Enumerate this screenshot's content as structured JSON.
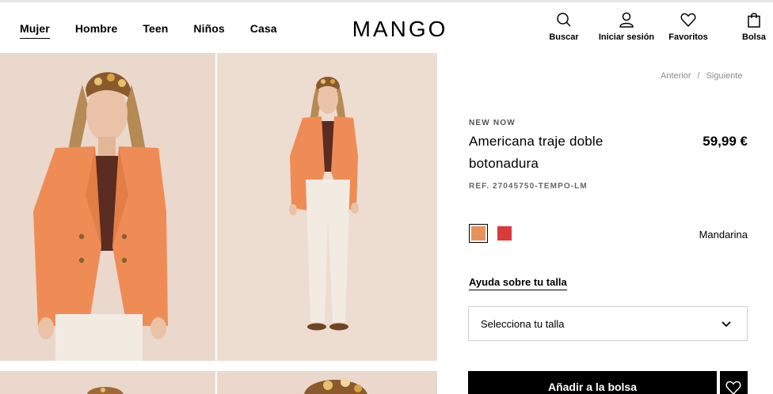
{
  "header": {
    "nav": [
      {
        "label": "Mujer",
        "active": true
      },
      {
        "label": "Hombre",
        "active": false
      },
      {
        "label": "Teen",
        "active": false
      },
      {
        "label": "Niños",
        "active": false
      },
      {
        "label": "Casa",
        "active": false
      }
    ],
    "logo_text": "MANGO",
    "actions": {
      "search": "Buscar",
      "login": "Iniciar sesión",
      "favorites": "Favoritos",
      "bag": "Bolsa"
    }
  },
  "pager": {
    "previous": "Anterior",
    "separator": "/",
    "next": "Siguiente"
  },
  "product": {
    "tag": "NEW NOW",
    "title": "Americana traje doble botonadura",
    "price": "59,99 €",
    "ref": "REF. 27045750-TEMPO-LM",
    "colors": [
      {
        "name": "Mandarina",
        "hex": "#e8925a",
        "selected": true
      },
      {
        "name": "",
        "hex": "#d93a3a",
        "selected": false
      }
    ],
    "selected_color_name": "Mandarina",
    "size_help": "Ayuda sobre tu talla",
    "size_select": "Selecciona tu talla",
    "add_to_bag": "Añadir a la bolsa"
  },
  "icons": {
    "search": "search-icon",
    "user": "user-icon",
    "heart": "heart-icon",
    "bag": "bag-icon",
    "chevron": "chevron-down-icon"
  }
}
